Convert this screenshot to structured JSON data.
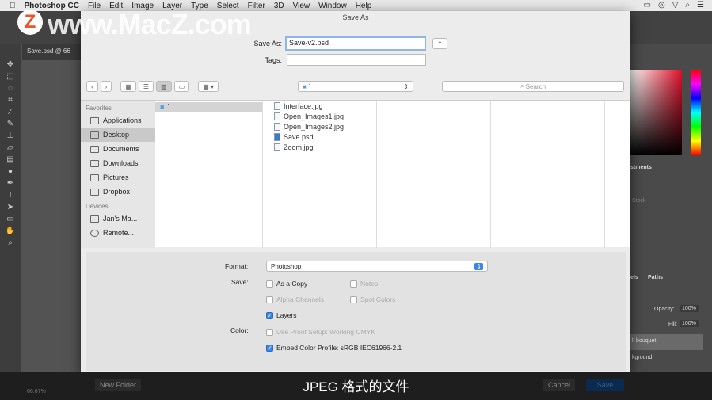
{
  "menubar": {
    "app": "Photoshop CC",
    "items": [
      "File",
      "Edit",
      "Image",
      "Layer",
      "Type",
      "Select",
      "Filter",
      "3D",
      "View",
      "Window",
      "Help"
    ]
  },
  "watermark": "www.MacZ.com",
  "document_tab": "Save.psd @ 66",
  "zoom_level": "66.67%",
  "dialog": {
    "title": "Save As",
    "save_as_label": "Save As:",
    "filename": "Save-v2.psd",
    "tags_label": "Tags:",
    "tags_value": "",
    "location": "`",
    "search_placeholder": "Search",
    "sidebar": {
      "favorites_header": "Favorites",
      "favorites": [
        "Applications",
        "Desktop",
        "Documents",
        "Downloads",
        "Pictures",
        "Dropbox"
      ],
      "selected": "Desktop",
      "devices_header": "Devices",
      "devices": [
        "Jan's Ma...",
        "Remote..."
      ]
    },
    "folder_column": [
      "`"
    ],
    "files": [
      "Interface.jpg",
      "Open_Images1.jpg",
      "Open_Images2.jpg",
      "Save.psd",
      "Zoom.jpg"
    ],
    "format_label": "Format:",
    "format_value": "Photoshop",
    "save_label": "Save:",
    "options": {
      "as_a_copy": "As a Copy",
      "notes": "Notes",
      "alpha_channels": "Alpha Channels",
      "spot_colors": "Spot Colors",
      "layers": "Layers"
    },
    "color_label": "Color:",
    "use_proof": "Use Proof Setup:  Working CMYK",
    "embed_profile": "Embed Color Profile:  sRGB IEC61966-2.1",
    "new_folder": "New Folder",
    "cancel": "Cancel",
    "save": "Save"
  },
  "right_panel": {
    "adjustments": "stments",
    "stock": "Stock",
    "channels": "els",
    "paths": "Paths",
    "opacity_label": "Opacity:",
    "opacity": "100%",
    "fill_label": "Fill:",
    "fill": "100%",
    "layers": [
      "ll bouquet",
      "kground"
    ]
  },
  "subtitle": "JPEG 格式的文件"
}
